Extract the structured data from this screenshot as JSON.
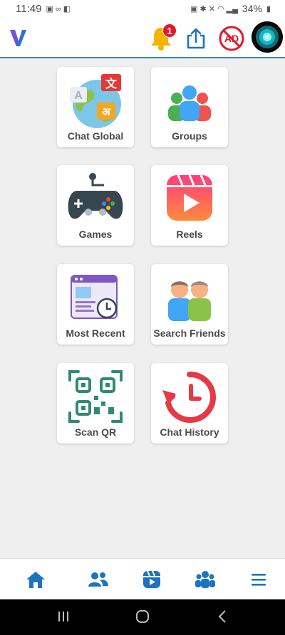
{
  "status_bar": {
    "time": "11:49",
    "battery": "34%"
  },
  "header": {
    "notification_count": "1",
    "no_ad_label": "AD"
  },
  "tiles": [
    {
      "label": "Chat Global",
      "icon": "globe-translate-icon"
    },
    {
      "label": "Groups",
      "icon": "group-people-icon"
    },
    {
      "label": "Games",
      "icon": "gamepad-icon"
    },
    {
      "label": "Reels",
      "icon": "reels-play-icon"
    },
    {
      "label": "Most Recent",
      "icon": "recent-clock-icon"
    },
    {
      "label": "Search Friends",
      "icon": "search-friends-icon"
    },
    {
      "label": "Scan QR",
      "icon": "qr-code-icon"
    },
    {
      "label": "Chat History",
      "icon": "history-clock-icon"
    }
  ],
  "bottom_nav": [
    "home-icon",
    "friends-icon",
    "reels-icon",
    "groups-icon",
    "menu-icon"
  ],
  "colors": {
    "accent": "#1e73be",
    "header_border": "#3b82c4",
    "badge": "#e0192c"
  }
}
